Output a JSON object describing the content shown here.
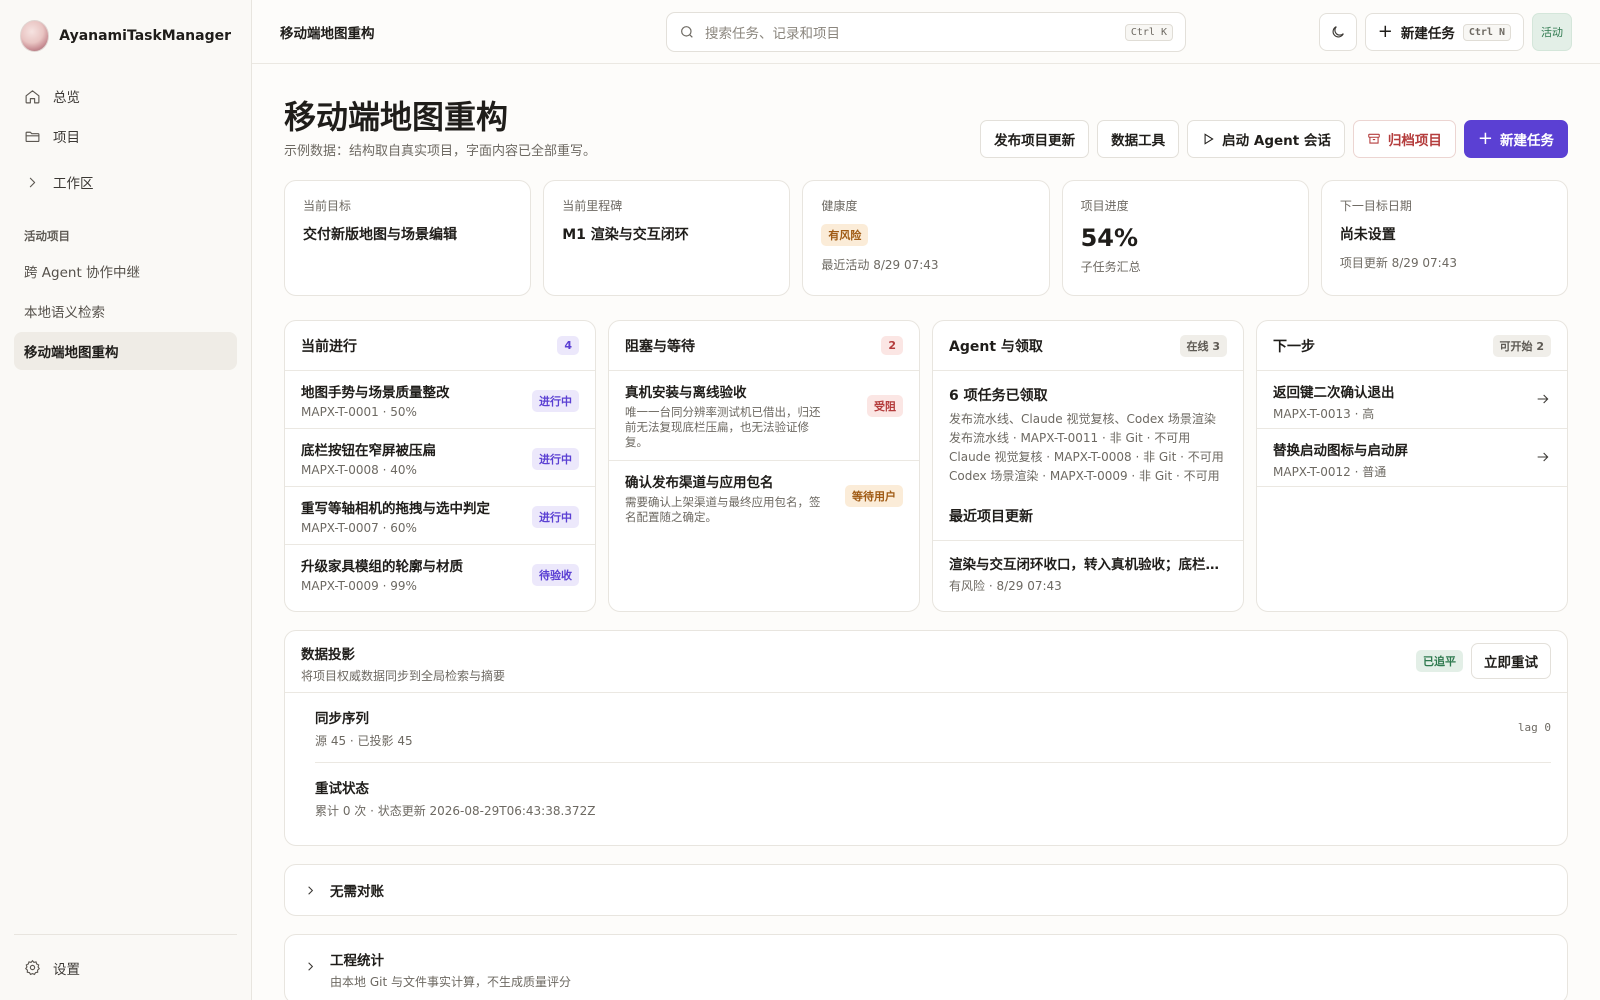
{
  "app": {
    "name": "AyanamiTaskManager"
  },
  "sidebar": {
    "nav": [
      {
        "label": "总览"
      },
      {
        "label": "项目"
      }
    ],
    "workspace_label": "工作区",
    "section_label": "活动项目",
    "projects": [
      {
        "label": "跨 Agent 协作中继"
      },
      {
        "label": "本地语义检索"
      },
      {
        "label": "移动端地图重构"
      }
    ],
    "settings_label": "设置"
  },
  "topbar": {
    "title": "移动端地图重构",
    "search_placeholder": "搜索任务、记录和项目",
    "search_kbd": "Ctrl K",
    "new_task_label": "新建任务",
    "new_task_kbd": "Ctrl N",
    "status_label": "活动"
  },
  "page": {
    "title": "移动端地图重构",
    "subtitle": "示例数据：结构取自真实项目，字面内容已全部重写。",
    "actions": {
      "publish": "发布项目更新",
      "data_tools": "数据工具",
      "start_agent": "启动 Agent 会话",
      "archive": "归档项目",
      "new_task": "新建任务"
    }
  },
  "stats": [
    {
      "label": "当前目标",
      "value": "交付新版地图与场景编辑"
    },
    {
      "label": "当前里程碑",
      "value": "M1 渲染与交互闭环"
    },
    {
      "label": "健康度",
      "badge": "有风险",
      "note": "最近活动 8/29 07:43"
    },
    {
      "label": "项目进度",
      "value": "54%",
      "note": "子任务汇总"
    },
    {
      "label": "下一目标日期",
      "value": "尚未设置",
      "note": "项目更新 8/29 07:43"
    }
  ],
  "in_progress": {
    "title": "当前进行",
    "count": "4",
    "tasks": [
      {
        "title": "地图手势与场景质量整改",
        "meta": "MAPX-T-0001 · 50%",
        "badge": "进行中"
      },
      {
        "title": "底栏按钮在窄屏被压扁",
        "meta": "MAPX-T-0008 · 40%",
        "badge": "进行中"
      },
      {
        "title": "重写等轴相机的拖拽与选中判定",
        "meta": "MAPX-T-0007 · 60%",
        "badge": "进行中"
      },
      {
        "title": "升级家具模组的轮廓与材质",
        "meta": "MAPX-T-0009 · 99%",
        "badge": "待验收"
      }
    ]
  },
  "blocked": {
    "title": "阻塞与等待",
    "count": "2",
    "items": [
      {
        "title": "真机安装与离线验收",
        "desc": "唯一一台同分辨率测试机已借出，归还前无法复现底栏压扁，也无法验证修复。",
        "badge": "受阻"
      },
      {
        "title": "确认发布渠道与应用包名",
        "desc": "需要确认上架渠道与最终应用包名，签名配置随之确定。",
        "badge": "等待用户"
      }
    ]
  },
  "agents": {
    "title": "Agent 与领取",
    "online": "在线 3",
    "claimed_title": "6 项任务已领取",
    "lines": [
      "发布流水线、Claude 视觉复核、Codex 场景渲染",
      "发布流水线 · MAPX-T-0011 · 非 Git · 不可用",
      "Claude 视觉复核 · MAPX-T-0008 · 非 Git · 不可用",
      "Codex 场景渲染 · MAPX-T-0009 · 非 Git · 不可用"
    ],
    "recent_title": "最近项目更新",
    "recent_update": "渲染与交互闭环收口，转入真机验收；底栏按钮问题待复现",
    "recent_meta": "有风险 · 8/29 07:43"
  },
  "next": {
    "title": "下一步",
    "count": "可开始 2",
    "items": [
      {
        "title": "返回键二次确认退出",
        "meta": "MAPX-T-0013 · 高"
      },
      {
        "title": "替换启动图标与启动屏",
        "meta": "MAPX-T-0012 · 普通"
      }
    ]
  },
  "projection": {
    "title": "数据投影",
    "desc": "将项目权威数据同步到全局检索与摘要",
    "status": "已追平",
    "retry_label": "立即重试",
    "rows": [
      {
        "title": "同步序列",
        "meta": "源 45 · 已投影 45",
        "lag": "lag 0"
      },
      {
        "title": "重试状态",
        "meta": "累计 0 次 · 状态更新 2026-08-29T06:43:38.372Z"
      }
    ]
  },
  "collapsibles": [
    {
      "title": "无需对账"
    },
    {
      "title": "工程统计",
      "desc": "由本地 Git 与文件事实计算，不生成质量评分"
    }
  ],
  "colors": {
    "accent": "#5b40d3",
    "danger": "#b43c3c",
    "warn": "#a05b15",
    "ok": "#2f7a4f"
  }
}
